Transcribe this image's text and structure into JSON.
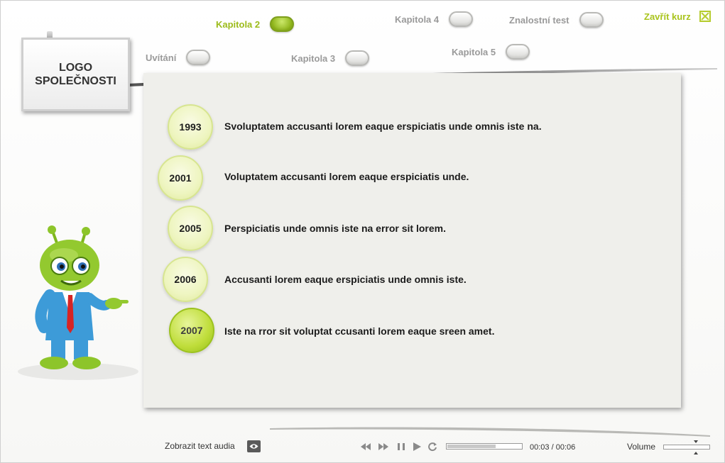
{
  "nav": {
    "items": [
      {
        "label": "Kapitola 2",
        "active": true
      },
      {
        "label": "Kapitola 4",
        "active": false
      },
      {
        "label": "Znalostní test",
        "active": false
      },
      {
        "label": "Uvítání",
        "active": false
      },
      {
        "label": "Kapitola 3",
        "active": false
      },
      {
        "label": "Kapitola 5",
        "active": false
      }
    ],
    "close_label": "Zavřít kurz"
  },
  "logo": {
    "line1": "LOGO",
    "line2": "SPOLEČNOSTI"
  },
  "timeline": [
    {
      "year": "1993",
      "text": "Svoluptatem accusanti lorem eaque erspiciatis unde omnis iste na.",
      "active": false
    },
    {
      "year": "2001",
      "text": "Voluptatem accusanti lorem eaque erspiciatis unde.",
      "active": false
    },
    {
      "year": "2005",
      "text": "Perspiciatis unde omnis iste na error sit lorem.",
      "active": false
    },
    {
      "year": "2006",
      "text": "Accusanti lorem eaque erspiciatis unde omnis iste.",
      "active": false
    },
    {
      "year": "2007",
      "text": "Iste na rror sit voluptat ccusanti lorem eaque sreen amet.",
      "active": true
    }
  ],
  "player": {
    "audio_text_label": "Zobrazit text audia",
    "current_time": "00:03",
    "separator": "/",
    "total_time": "00:06",
    "progress_fraction": 0.65,
    "volume_label": "Volume",
    "volume_fraction": 0.7
  },
  "colors": {
    "accent": "#9cbb1a",
    "panel": "#efefeb",
    "nav_inactive": "#9a9a9a"
  }
}
